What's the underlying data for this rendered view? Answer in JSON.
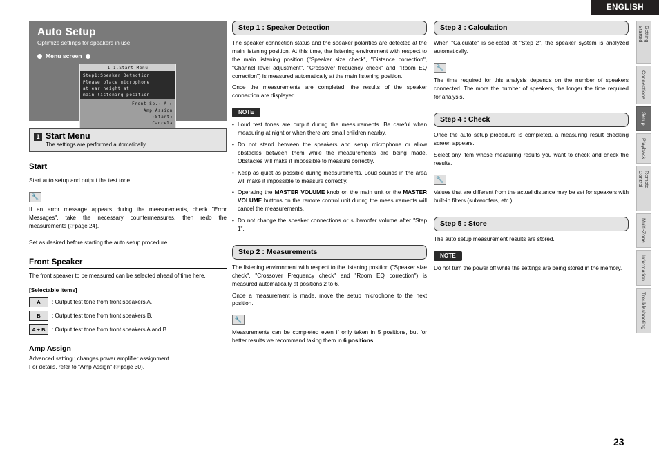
{
  "header": {
    "language": "ENGLISH"
  },
  "page_number": "23",
  "side_tabs": [
    {
      "label": "Getting Started",
      "active": false
    },
    {
      "label": "Connections",
      "active": false
    },
    {
      "label": "Setup",
      "active": true
    },
    {
      "label": "Playback",
      "active": false
    },
    {
      "label": "Remote Control",
      "active": false
    },
    {
      "label": "Multi-Zone",
      "active": false
    },
    {
      "label": "Information",
      "active": false
    },
    {
      "label": "Troubleshooting",
      "active": false
    }
  ],
  "auto_setup": {
    "title": "Auto Setup",
    "subtitle": "Optimize settings for speakers in use.",
    "menu_screen_label": "Menu screen",
    "osd": {
      "title": "1-1.Start Menu",
      "dark_lines": [
        "Step1:Speaker Detection",
        "Please place microphone",
        "at ear height at",
        "main listening position"
      ],
      "light_lines": [
        "Front Sp.◂ A ▸",
        "Amp Assign",
        "▸Start◂",
        "Cancel◂"
      ]
    }
  },
  "start_menu_section": {
    "number": "1",
    "title": "Start Menu",
    "subtitle": "The settings are performed automatically."
  },
  "start": {
    "heading": "Start",
    "p1": "Start auto setup and output the test tone.",
    "note1": "If an error message appears during the measurements, check \"Error Messages\", take the necessary countermeasures, then redo the measurements (☞page 24).",
    "p2": "Set as desired before starting the auto setup procedure."
  },
  "front_speaker": {
    "heading": "Front Speaker",
    "p1": "The front speaker to be measured can be selected ahead of time here.",
    "selectable_label": "[Selectable items]",
    "items": [
      {
        "key": "A",
        "desc": ": Output test tone from front speakers A."
      },
      {
        "key": "B",
        "desc": ": Output test tone from front speakers B."
      },
      {
        "key": "A + B",
        "desc": ": Output test tone from front speakers A and B."
      }
    ]
  },
  "amp_assign": {
    "heading": "Amp Assign",
    "p1": "Advanced setting : changes power amplifier assignment.",
    "p2": "For details, refer to \"Amp Assign\" (☞page 30)."
  },
  "step1": {
    "title": "Step 1 : Speaker Detection",
    "p1": "The speaker connection status and the speaker polarities are detected at the main listening position. At this time, the listening environment with respect to the main listening position (\"Speaker size check\", \"Distance correction\", \"Channel level adjustment\", \"Crossover frequency check\" and \"Room EQ correction\") is measured automatically at the main listening position.",
    "p2": "Once the measurements are completed, the results of the speaker connection are displayed.",
    "note_label": "NOTE",
    "notes": [
      "Loud test tones are output during the measurements. Be careful when measuring at night or when there are small children nearby.",
      "Do not stand between the speakers and setup microphone or allow obstacles between them while the measurements are being made. Obstacles will make it impossible to measure correctly.",
      "Keep as quiet as possible during measurements. Loud sounds in the area will make it impossible to measure correctly.",
      "Operating the MASTER VOLUME knob on the main unit or the MASTER VOLUME buttons on the remote control unit during the measurements will cancel the measurements.",
      "Do not change the speaker connections or subwoofer volume after \"Step 1\"."
    ]
  },
  "step2": {
    "title": "Step 2 : Measurements",
    "p1": "The listening environment with respect to the listening position (\"Speaker size check\", \"Crossover Frequency check\" and \"Room EQ correction\") is measured automatically at positions 2 to 6.",
    "p2": "Once a measurement is made, move the setup microphone to the next position.",
    "tip": "Measurements can be completed even if only taken in 5 positions, but for better results we recommend taking them in 6 positions."
  },
  "step3": {
    "title": "Step 3 : Calculation",
    "p1": "When \"Calculate\" is selected at \"Step 2\", the speaker system is analyzed automatically.",
    "tip": "The time required for this analysis depends on the number of speakers connected. The more the number of speakers, the longer the time required for analysis."
  },
  "step4": {
    "title": "Step 4 : Check",
    "p1": "Once the auto setup procedure is completed, a measuring result checking screen appears.",
    "p2": "Select any item whose measuring results you want to check and check the results.",
    "tip": "Values that are different from the actual distance may be set for speakers with built-in filters (subwoofers, etc.)."
  },
  "step5": {
    "title": "Step 5 : Store",
    "p1": "The auto setup measurement results are stored.",
    "note_label": "NOTE",
    "note": "Do not turn the power off while the settings are being stored in the memory."
  }
}
